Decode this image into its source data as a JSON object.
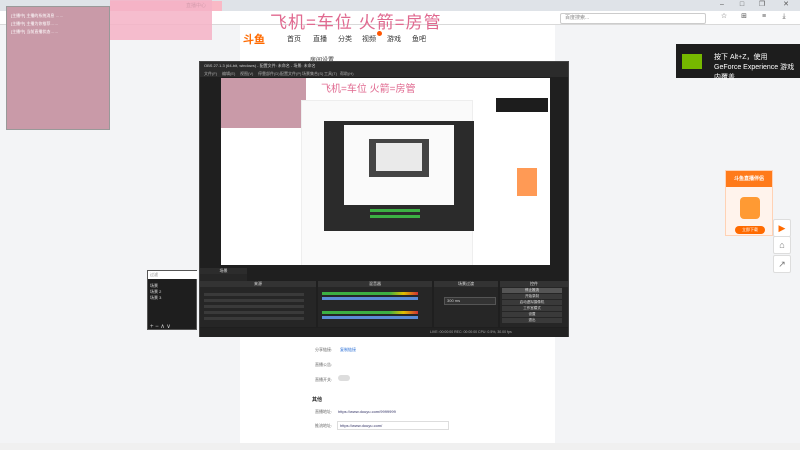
{
  "browser": {
    "tabs": [
      {
        "label": "",
        "active": false
      },
      {
        "label": "",
        "active": false
      },
      {
        "label": "",
        "active": true
      },
      {
        "label": "直播中心",
        "active": true
      }
    ],
    "address_text": "",
    "search_placeholder": "百度搜索...",
    "bottom_status": ""
  },
  "banner_text": "飞机=车位  火箭=房管",
  "page": {
    "logo": "斗鱼",
    "nav": [
      "首页",
      "直播",
      "分类",
      "视频",
      "游戏",
      "鱼吧"
    ],
    "nav_badge": "",
    "title": "房间设置"
  },
  "notifications": [
    "[主播中] 主播的系统消息 ……",
    "[主播中] 主播为你推荐……",
    "[主播中] 当前直播状态……"
  ],
  "obs": {
    "title": "OBS 27.1.3 (64-bit, windows) - 配置文件: 未命名 - 场景: 未命名",
    "menu": [
      "文件(F)",
      "编辑(E)",
      "视图(V)",
      "停靠部件(D)",
      "配置文件(P)",
      "场景集合(S)",
      "工具(T)",
      "帮助(H)"
    ],
    "docks": {
      "scenes": "场景",
      "sources": "来源",
      "mixer": "混音器",
      "transitions": "场景过渡",
      "controls": "控件"
    },
    "controls": [
      "停止推流",
      "开始录制",
      "启动虚拟摄像机",
      "工作室模式",
      "设置",
      "退出"
    ],
    "transition_duration": "300 ms",
    "status": "LIVE: 00:00:00   REC: 00:00:00   CPU: 0.5%, 30.00 fps",
    "preview_banner": "飞机=车位  火箭=房管"
  },
  "scenes": [
    "场景",
    "场景 2",
    "场景 3"
  ],
  "scene_filter": "过滤",
  "form": {
    "section_label": "其他",
    "url_label": "直播地址:",
    "url_value": "https://www.douyu.com/9999999",
    "push_label": "推流地址:",
    "push_value": "https://www.douyu.com/",
    "share_label": "分享链接:",
    "share_value": "复制链接",
    "notice_label": "直播公告:",
    "toggle_label": "直播开关:"
  },
  "nvidia": {
    "text": "按下 Alt+Z，使用 GeForce Experience 游戏内覆盖"
  },
  "promo": {
    "header": "斗鱼直播伴侣",
    "button": "立即下载"
  },
  "colors": {
    "accent": "#ff6a00",
    "banner": "#e06a90",
    "nvidia_green": "#76b900"
  }
}
